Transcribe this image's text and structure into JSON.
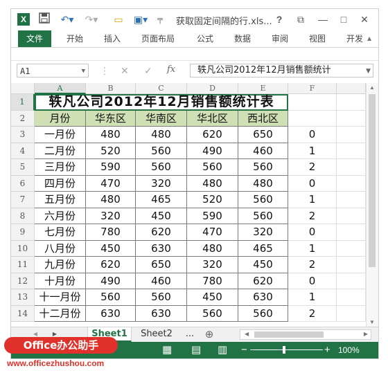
{
  "titlebar": {
    "app_logo": "X",
    "save_icon": "save-icon",
    "undo_glyph": "↶▾",
    "redo_glyph": "↷▾",
    "folder_glyph": "▭",
    "print_glyph": "▣▾",
    "customize_glyph": "╤",
    "title": "获取固定间隔的行.xls...",
    "help": "?",
    "restore": "⧉",
    "minimize": "—",
    "maximize": "□",
    "close": "✕"
  },
  "ribbon_tabs": [
    "文件",
    "开始",
    "插入",
    "页面布局",
    "公式",
    "数据",
    "审阅",
    "视图",
    "开发"
  ],
  "ribbon_scroll": "▲",
  "formula_bar": {
    "name_box": "A1",
    "cancel": "✕",
    "enter": "✓",
    "fx": "fx",
    "formula": "轶凡公司2012年12月销售额统计"
  },
  "columns": [
    "A",
    "B",
    "C",
    "D",
    "E",
    "F"
  ],
  "rows": [
    "1",
    "2",
    "3",
    "4",
    "5",
    "6",
    "7",
    "8",
    "9",
    "10",
    "11",
    "12",
    "13",
    "14"
  ],
  "sheet_title": "轶凡公司2012年12月销售额统计表",
  "table_headers": [
    "月份",
    "华东区",
    "华南区",
    "华北区",
    "西北区"
  ],
  "table_rows": [
    [
      "一月份",
      "480",
      "480",
      "620",
      "650",
      "0"
    ],
    [
      "二月份",
      "520",
      "560",
      "490",
      "460",
      "1"
    ],
    [
      "三月份",
      "590",
      "560",
      "560",
      "560",
      "2"
    ],
    [
      "四月份",
      "470",
      "320",
      "480",
      "480",
      "0"
    ],
    [
      "五月份",
      "480",
      "465",
      "520",
      "560",
      "1"
    ],
    [
      "六月份",
      "320",
      "450",
      "590",
      "560",
      "2"
    ],
    [
      "七月份",
      "780",
      "620",
      "470",
      "320",
      "0"
    ],
    [
      "八月份",
      "450",
      "630",
      "480",
      "465",
      "1"
    ],
    [
      "九月份",
      "620",
      "650",
      "320",
      "450",
      "2"
    ],
    [
      "十月份",
      "490",
      "460",
      "780",
      "620",
      "0"
    ],
    [
      "十一月份",
      "560",
      "560",
      "450",
      "630",
      "1"
    ],
    [
      "十二月份",
      "630",
      "630",
      "560",
      "560",
      "2"
    ]
  ],
  "sheet_tabs": {
    "nav_left": "◀",
    "nav_right": "▶",
    "tabs": [
      "Sheet1",
      "Sheet2"
    ],
    "more": "...",
    "add": "⊕"
  },
  "status": {
    "normal_view": "▦",
    "page_layout_view": "▤",
    "page_break_view": "▥",
    "zoom_out": "−",
    "zoom_in": "+",
    "zoom": "100%"
  },
  "watermark": {
    "badge": "Office办公助手",
    "url": "www.officezhushou.com"
  },
  "colors": {
    "accent": "#217346",
    "header_fill": "#cfe0b5",
    "watermark": "#e0322b"
  }
}
